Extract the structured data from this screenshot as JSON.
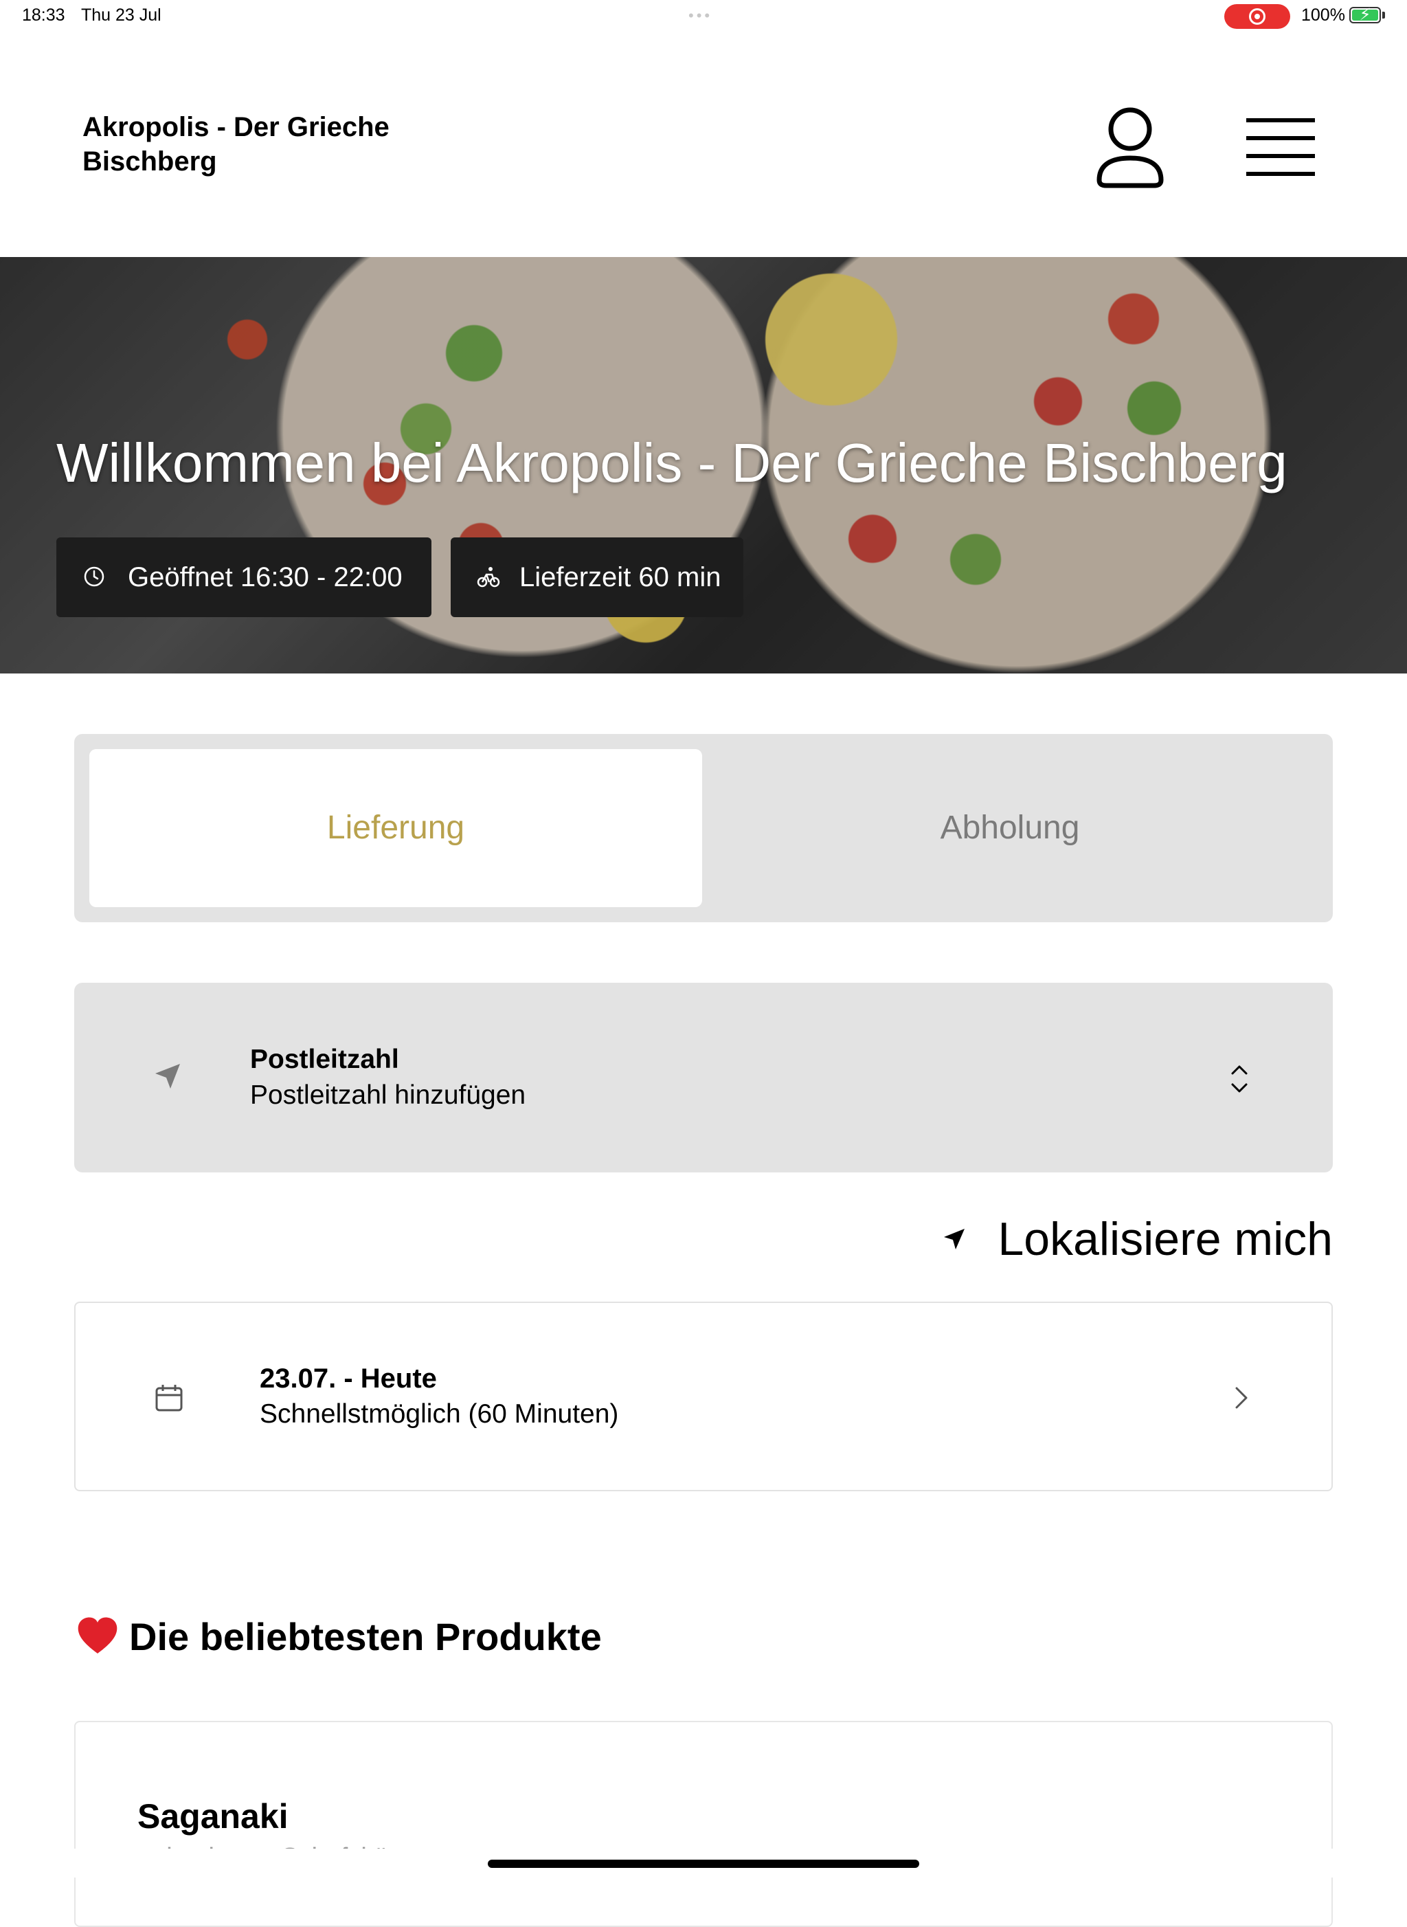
{
  "status_bar": {
    "time": "18:33",
    "date": "Thu 23 Jul",
    "battery_percent": "100%",
    "recording_color": "#e8302e",
    "battery_color": "#34c759"
  },
  "header": {
    "title": "Akropolis - Der Grieche Bischberg",
    "user_icon": "user-icon",
    "menu_icon": "hamburger-menu-icon"
  },
  "hero": {
    "title": "Willkommen bei Akropolis - Der Grieche Bischberg",
    "opening_hours": "Geöffnet 16:30 - 22:00",
    "delivery_time": "Lieferzeit 60 min",
    "opening_icon": "clock-icon",
    "delivery_icon": "bicycle-icon"
  },
  "order_mode": {
    "tabs": [
      {
        "label": "Lieferung",
        "active": true
      },
      {
        "label": "Abholung",
        "active": false
      }
    ],
    "accent_color": "#b8a14d"
  },
  "postcode": {
    "icon": "location-arrow-icon",
    "title": "Postleitzahl",
    "placeholder": "Postleitzahl hinzufügen",
    "trailing_icon": "chevron-up-down-icon"
  },
  "localize": {
    "icon": "location-arrow-icon",
    "label": "Lokalisiere mich"
  },
  "delivery_date": {
    "icon": "calendar-icon",
    "title": "23.07. - Heute",
    "subtitle": "Schnellstmöglich (60 Minuten)",
    "trailing_icon": "chevron-right-icon"
  },
  "popular": {
    "icon": "heart-icon",
    "title": "Die beliebtesten Produkte",
    "products": [
      {
        "name": "Saganaki",
        "description": "gebackener Schafskäse"
      }
    ]
  }
}
